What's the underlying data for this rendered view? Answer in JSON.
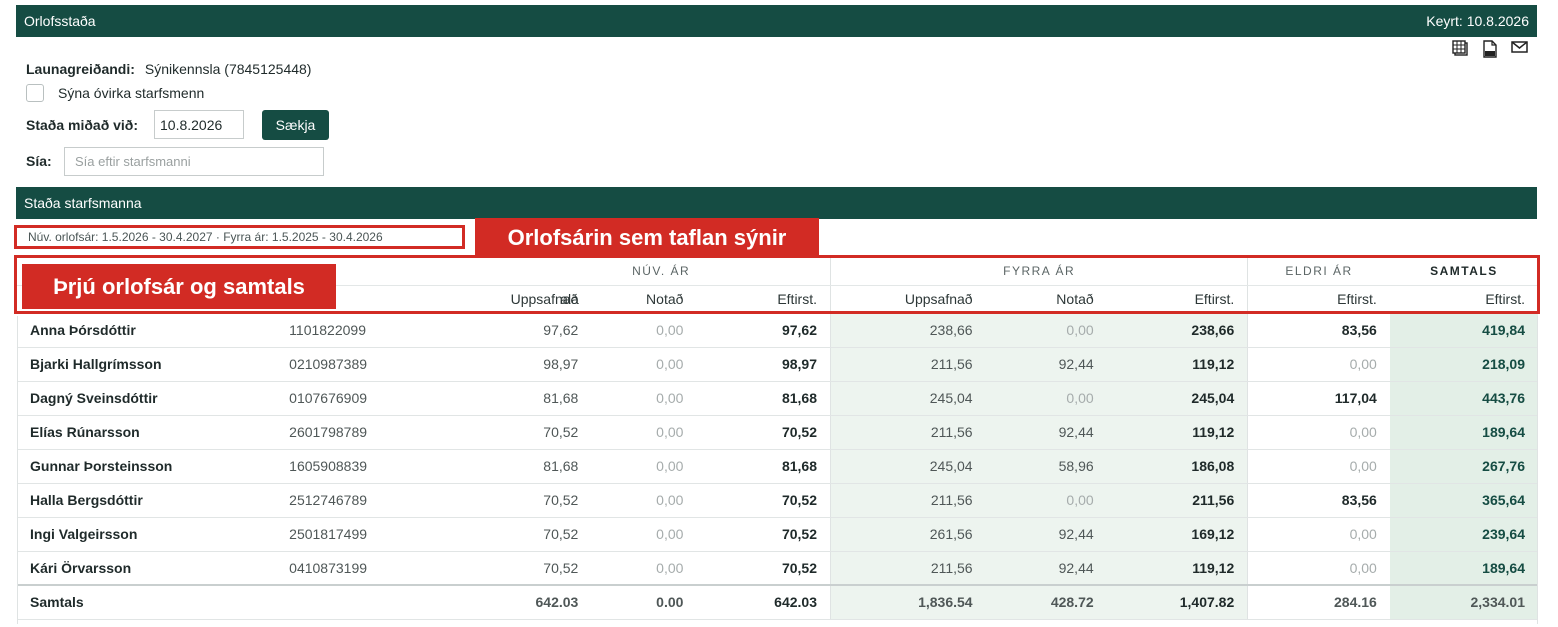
{
  "header": {
    "title": "Orlofsstaða",
    "run_date": "Keyrt: 10.8.2026"
  },
  "toolbar_icons": [
    "excel-icon",
    "pdf-icon",
    "email-icon"
  ],
  "form": {
    "employer_label": "Launagreiðandi:",
    "employer_value": "Sýnikennsla (7845125448)",
    "inactive_checkbox_label": "Sýna óvirka starfsmenn",
    "inactive_checked": false,
    "date_label": "Staða miðað við:",
    "date_value": "10.8.2026",
    "fetch_button": "Sækja",
    "filter_label": "Sía:",
    "filter_placeholder": "Sía eftir starfsmanni",
    "filter_value": ""
  },
  "section": {
    "title": "Staða starfsmanna",
    "period_text": "Núv. orlofsár: 1.5.2026 - 30.4.2027 · Fyrra ár: 1.5.2025 - 30.4.2026"
  },
  "annotations": {
    "period_callout": "Orlofsárin sem taflan sýnir",
    "header_callout": "Þrjú orlofsár og samtals"
  },
  "table": {
    "groups": {
      "current": "NÚV. ÁR",
      "previous": "FYRRA ÁR",
      "older": "ELDRI ÁR",
      "total": "SAMTALS"
    },
    "columns": {
      "kennitala_fragment": "ala",
      "accrued": "Uppsafnað",
      "used": "Notað",
      "remaining": "Eftirst."
    },
    "rows": [
      {
        "name": "Anna Þórsdóttir",
        "kt": "1101822099",
        "cur_acc": "97,62",
        "cur_used": "0,00",
        "cur_rem": "97,62",
        "prev_acc": "238,66",
        "prev_used": "0,00",
        "prev_rem": "238,66",
        "old_rem": "83,56",
        "total": "419,84"
      },
      {
        "name": "Bjarki Hallgrímsson",
        "kt": "0210987389",
        "cur_acc": "98,97",
        "cur_used": "0,00",
        "cur_rem": "98,97",
        "prev_acc": "211,56",
        "prev_used": "92,44",
        "prev_rem": "119,12",
        "old_rem": "0,00",
        "total": "218,09"
      },
      {
        "name": "Dagný Sveinsdóttir",
        "kt": "0107676909",
        "cur_acc": "81,68",
        "cur_used": "0,00",
        "cur_rem": "81,68",
        "prev_acc": "245,04",
        "prev_used": "0,00",
        "prev_rem": "245,04",
        "old_rem": "117,04",
        "total": "443,76"
      },
      {
        "name": "Elías Rúnarsson",
        "kt": "2601798789",
        "cur_acc": "70,52",
        "cur_used": "0,00",
        "cur_rem": "70,52",
        "prev_acc": "211,56",
        "prev_used": "92,44",
        "prev_rem": "119,12",
        "old_rem": "0,00",
        "total": "189,64"
      },
      {
        "name": "Gunnar Þorsteinsson",
        "kt": "1605908839",
        "cur_acc": "81,68",
        "cur_used": "0,00",
        "cur_rem": "81,68",
        "prev_acc": "245,04",
        "prev_used": "58,96",
        "prev_rem": "186,08",
        "old_rem": "0,00",
        "total": "267,76"
      },
      {
        "name": "Halla Bergsdóttir",
        "kt": "2512746789",
        "cur_acc": "70,52",
        "cur_used": "0,00",
        "cur_rem": "70,52",
        "prev_acc": "211,56",
        "prev_used": "0,00",
        "prev_rem": "211,56",
        "old_rem": "83,56",
        "total": "365,64"
      },
      {
        "name": "Ingi Valgeirsson",
        "kt": "2501817499",
        "cur_acc": "70,52",
        "cur_used": "0,00",
        "cur_rem": "70,52",
        "prev_acc": "261,56",
        "prev_used": "92,44",
        "prev_rem": "169,12",
        "old_rem": "0,00",
        "total": "239,64"
      },
      {
        "name": "Kári Örvarsson",
        "kt": "0410873199",
        "cur_acc": "70,52",
        "cur_used": "0,00",
        "cur_rem": "70,52",
        "prev_acc": "211,56",
        "prev_used": "92,44",
        "prev_rem": "119,12",
        "old_rem": "0,00",
        "total": "189,64"
      }
    ],
    "totals": {
      "label": "Samtals",
      "cur_acc": "642.03",
      "cur_used": "0.00",
      "cur_rem": "642.03",
      "prev_acc": "1,836.54",
      "prev_used": "428.72",
      "prev_rem": "1,407.82",
      "old_rem": "284.16",
      "total": "2,334.01"
    }
  },
  "colors": {
    "brand": "#154c43",
    "annotation": "#d22b24",
    "tint": "#edf4ef"
  }
}
